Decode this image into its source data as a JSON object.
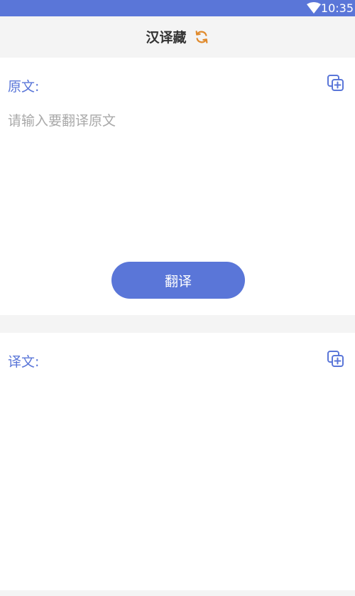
{
  "status_bar": {
    "time": "10:35",
    "wifi_icon": "wifi-icon",
    "color": "#5a76d8"
  },
  "app_bar": {
    "title": "汉译藏",
    "swap_icon": "swap-direction-icon",
    "swap_icon_color": "#e08a2c"
  },
  "source_panel": {
    "label": "原文:",
    "copy_icon": "copy-add-icon",
    "input_value": "",
    "input_placeholder": "请输入要翻译原文",
    "translate_button_label": "翻译"
  },
  "target_panel": {
    "label": "译文:",
    "copy_icon": "copy-add-icon",
    "output_value": ""
  },
  "colors": {
    "accent": "#5a76d8",
    "background": "#f4f4f4",
    "panel": "#ffffff",
    "placeholder": "#a9a9a9"
  }
}
